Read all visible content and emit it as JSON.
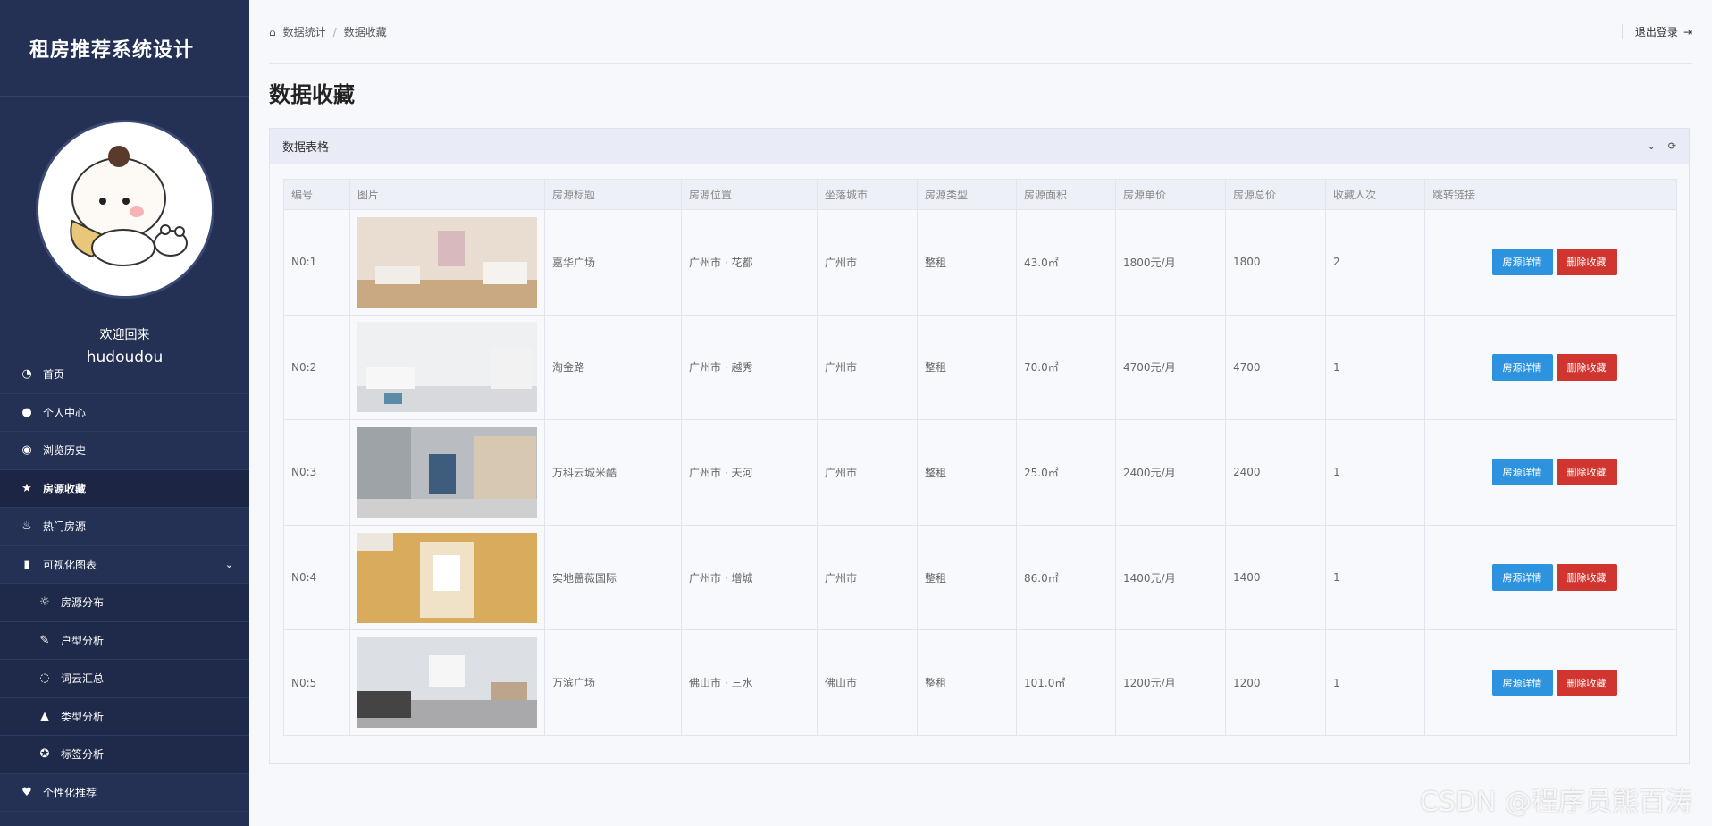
{
  "brand": {
    "title": "租房推荐系统设计"
  },
  "profile": {
    "welcome": "欢迎回来",
    "username": "hudoudou"
  },
  "sidebar": {
    "items": [
      {
        "label": "首页",
        "icon": "dashboard-icon"
      },
      {
        "label": "个人中心",
        "icon": "user-icon"
      },
      {
        "label": "浏览历史",
        "icon": "eye-icon"
      },
      {
        "label": "房源收藏",
        "icon": "star-icon",
        "active": true
      },
      {
        "label": "热门房源",
        "icon": "fire-icon"
      },
      {
        "label": "可视化图表",
        "icon": "bar-chart-icon",
        "expanded": true
      },
      {
        "label": "房源分布",
        "icon": "sun-icon",
        "sub": true
      },
      {
        "label": "户型分析",
        "icon": "feather-icon",
        "sub": true
      },
      {
        "label": "词云汇总",
        "icon": "lightbulb-icon",
        "sub": true
      },
      {
        "label": "类型分析",
        "icon": "graduation-cap-icon",
        "sub": true
      },
      {
        "label": "标签分析",
        "icon": "palette-icon",
        "sub": true
      },
      {
        "label": "个性化推荐",
        "icon": "heart-icon"
      }
    ]
  },
  "breadcrumb": {
    "home": "数据统计",
    "current": "数据收藏"
  },
  "header": {
    "logout": "退出登录"
  },
  "page": {
    "title": "数据收藏"
  },
  "panel": {
    "title": "数据表格"
  },
  "table": {
    "headers": [
      "编号",
      "图片",
      "房源标题",
      "房源位置",
      "坐落城市",
      "房源类型",
      "房源面积",
      "房源单价",
      "房源总价",
      "收藏人次",
      "跳转链接"
    ],
    "rows": [
      {
        "id": "N0:1",
        "title": "嘉华广场",
        "location": "广州市 · 花都",
        "city": "广州市",
        "type": "整租",
        "area": "43.0㎡",
        "unit_price": "1800元/月",
        "total": "1800",
        "favorites": "2"
      },
      {
        "id": "N0:2",
        "title": "淘金路",
        "location": "广州市 · 越秀",
        "city": "广州市",
        "type": "整租",
        "area": "70.0㎡",
        "unit_price": "4700元/月",
        "total": "4700",
        "favorites": "1"
      },
      {
        "id": "N0:3",
        "title": "万科云城米酷",
        "location": "广州市 · 天河",
        "city": "广州市",
        "type": "整租",
        "area": "25.0㎡",
        "unit_price": "2400元/月",
        "total": "2400",
        "favorites": "1"
      },
      {
        "id": "N0:4",
        "title": "实地蔷薇国际",
        "location": "广州市 · 增城",
        "city": "广州市",
        "type": "整租",
        "area": "86.0㎡",
        "unit_price": "1400元/月",
        "total": "1400",
        "favorites": "1"
      },
      {
        "id": "N0:5",
        "title": "万滨广场",
        "location": "佛山市 · 三水",
        "city": "佛山市",
        "type": "整租",
        "area": "101.0㎡",
        "unit_price": "1200元/月",
        "total": "1200",
        "favorites": "1"
      }
    ],
    "detail_label": "房源详情",
    "delete_label": "删除收藏"
  },
  "watermark": "CSDN @程序员熊百涛",
  "colors": {
    "sidebar": "#243154",
    "primary": "#2d93df",
    "danger": "#d1352f"
  }
}
